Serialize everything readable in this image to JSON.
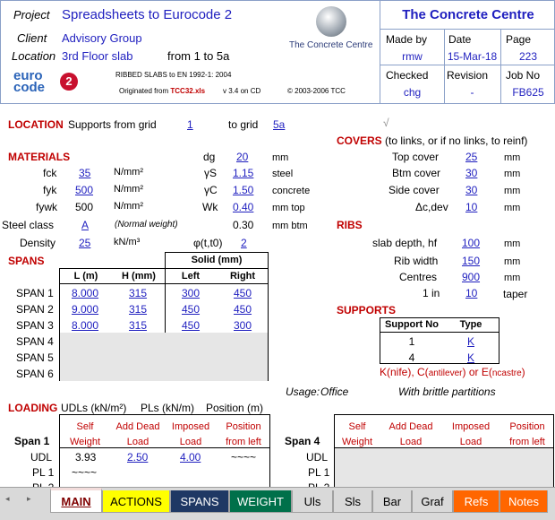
{
  "header": {
    "project_label": "Project",
    "project_value": "Spreadsheets to Eurocode 2",
    "client_label": "Client",
    "client_value": "Advisory Group",
    "location_label": "Location",
    "location_value": "3rd Floor slab",
    "location_range": "from 1 to 5a",
    "logo_text": "The Concrete Centre",
    "eurocode_logo_line1": "euro",
    "eurocode_logo_line2": "code",
    "eurocode_logo_num": "2",
    "ribbed_title": "RIBBED SLABS to EN 1992-1: 2004",
    "originated_from_prefix": "Originated from",
    "originated_from_file": "TCC32.xls",
    "version": "v 3.4 on CD",
    "copyright": "© 2003-2006 TCC",
    "company": "The Concrete Centre",
    "made_by_label": "Made by",
    "made_by_value": "rmw",
    "date_label": "Date",
    "date_value": "15-Mar-18",
    "page_label": "Page",
    "page_value": "223",
    "checked_label": "Checked",
    "checked_value": "chg",
    "revision_label": "Revision",
    "revision_value": "-",
    "job_label": "Job No",
    "job_value": "FB625"
  },
  "location": {
    "title": "LOCATION",
    "supports_from": "Supports from grid",
    "from_value": "1",
    "to_grid": "to grid",
    "to_value": "5a",
    "check": "√"
  },
  "materials": {
    "title": "MATERIALS",
    "fck_label": "fck",
    "fck_value": "35",
    "fck_unit": "N/mm²",
    "fyk_label": "fyk",
    "fyk_value": "500",
    "fyk_unit": "N/mm²",
    "fywk_label": "fywk",
    "fywk_value": "500",
    "fywk_unit": "N/mm²",
    "steel_class_label": "Steel class",
    "steel_class_value": "A",
    "steel_class_note": "(Normal weight)",
    "density_label": "Density",
    "density_value": "25",
    "density_unit": "kN/m³",
    "dg_label": "dg",
    "dg_value": "20",
    "dg_unit": "mm",
    "gs_label": "γS",
    "gs_value": "1.15",
    "gs_unit": "steel",
    "gc_label": "γC",
    "gc_value": "1.50",
    "gc_unit": "concrete",
    "wk_label": "Wk",
    "wk_value": "0.40",
    "wk_unit": "mm top",
    "btm_value": "0.30",
    "btm_unit": "mm btm",
    "phi_label": "φ(t,t0)",
    "phi_value": "2"
  },
  "covers": {
    "title": "COVERS",
    "note": "(to links, or if no links, to reinf)",
    "top_label": "Top cover",
    "top_value": "25",
    "top_unit": "mm",
    "btm_label": "Btm cover",
    "btm_value": "30",
    "btm_unit": "mm",
    "side_label": "Side cover",
    "side_value": "30",
    "side_unit": "mm",
    "dev_label": "Δc,dev",
    "dev_value": "10",
    "dev_unit": "mm"
  },
  "ribs": {
    "title": "RIBS",
    "depth_label": "slab depth, hf",
    "depth_value": "100",
    "depth_unit": "mm",
    "width_label": "Rib width",
    "width_value": "150",
    "width_unit": "mm",
    "centres_label": "Centres",
    "centres_value": "900",
    "centres_unit": "mm",
    "taper_label": "1 in",
    "taper_value": "10",
    "taper_unit": "taper"
  },
  "spans": {
    "title": "SPANS",
    "solid_header": "Solid (mm)",
    "col_l": "L (m)",
    "col_h": "H (mm)",
    "col_left": "Left",
    "col_right": "Right",
    "rows": [
      {
        "label": "SPAN 1",
        "l": "8.000",
        "h": "315",
        "left": "300",
        "right": "450"
      },
      {
        "label": "SPAN 2",
        "l": "9.000",
        "h": "315",
        "left": "450",
        "right": "450"
      },
      {
        "label": "SPAN 3",
        "l": "8.000",
        "h": "315",
        "left": "450",
        "right": "300"
      },
      {
        "label": "SPAN 4",
        "l": "",
        "h": "",
        "left": "",
        "right": ""
      },
      {
        "label": "SPAN 5",
        "l": "",
        "h": "",
        "left": "",
        "right": ""
      },
      {
        "label": "SPAN 6",
        "l": "",
        "h": "",
        "left": "",
        "right": ""
      }
    ]
  },
  "supports": {
    "title": "SUPPORTS",
    "col_no": "Support No",
    "col_type": "Type",
    "rows": [
      {
        "no": "1",
        "type": "K"
      },
      {
        "no": "4",
        "type": "K"
      }
    ],
    "legend_k": "K(nife), C(",
    "legend_ant": "antilever",
    "legend_or": ") or E(",
    "legend_nc": "ncastre",
    "legend_end": ")"
  },
  "usage": {
    "label": "Usage:",
    "value": "Office",
    "partition": "With brittle partitions"
  },
  "loading": {
    "title": "LOADING",
    "udls": "UDLs (kN/m²)",
    "pls": "PLs (kN/m)",
    "position": "Position (m)",
    "col_self1": "Self",
    "col_self2": "Weight",
    "col_dead1": "Add Dead",
    "col_dead2": "Load",
    "col_imp1": "Imposed",
    "col_imp2": "Load",
    "col_pos1": "Position",
    "col_pos2": "from left",
    "span1": "Span 1",
    "span4": "Span 4",
    "udl_label": "UDL",
    "pl1_label": "PL 1",
    "pl2_label": "PL 2",
    "udl_self": "3.93",
    "udl_dead": "2.50",
    "udl_imp": "4.00",
    "udl_pos": "~~~~",
    "pl1_self": "~~~~"
  },
  "tabs": [
    {
      "label": "MAIN",
      "bg": "#f2dcdb",
      "fg": "#7f0000"
    },
    {
      "label": "ACTIONS",
      "bg": "#ffff00",
      "fg": "#000000"
    },
    {
      "label": "SPANS",
      "bg": "#1f3864",
      "fg": "#ffffff"
    },
    {
      "label": "WEIGHT",
      "bg": "#00704a",
      "fg": "#ffffff"
    },
    {
      "label": "Uls",
      "bg": "#d9d9d9",
      "fg": "#000000"
    },
    {
      "label": "Sls",
      "bg": "#d9d9d9",
      "fg": "#000000"
    },
    {
      "label": "Bar",
      "bg": "#d9d9d9",
      "fg": "#000000"
    },
    {
      "label": "Graf",
      "bg": "#d9d9d9",
      "fg": "#000000"
    },
    {
      "label": "Refs",
      "bg": "#ff6600",
      "fg": "#ffffff"
    },
    {
      "label": "Notes",
      "bg": "#ff6600",
      "fg": "#ffffff"
    }
  ]
}
